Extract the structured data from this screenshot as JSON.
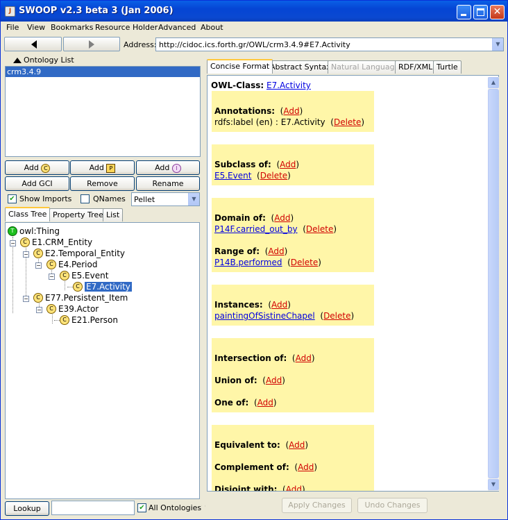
{
  "window": {
    "title": "SWOOP v2.3 beta 3 (Jan 2006)",
    "app_icon_glyph": "J"
  },
  "menu": [
    "File",
    "View",
    "Bookmarks",
    "Resource Holder",
    "Advanced",
    "About"
  ],
  "address": {
    "label": "Address:",
    "value": "http://cidoc.ics.forth.gr/OWL/crm3.4.9#E7.Activity"
  },
  "ontology_panel": {
    "header": "Ontology List",
    "items": [
      "crm3.4.9"
    ]
  },
  "buttons": {
    "add_class": "Add",
    "add_prop": "Add",
    "add_inst": "Add",
    "add_gci": "Add GCI",
    "remove": "Remove",
    "rename": "Rename",
    "class_badge": "C",
    "prop_badge": "P",
    "inst_badge": "I"
  },
  "options": {
    "show_imports": "Show Imports",
    "qnames": "QNames",
    "reasoner": "Pellet"
  },
  "left_tabs": [
    "Class Tree",
    "Property Tree",
    "List"
  ],
  "tree": {
    "thing_badge": "T",
    "class_badge": "C",
    "nodes": [
      "owl:Thing",
      "E1.CRM_Entity",
      "E2.Temporal_Entity",
      "E4.Period",
      "E5.Event",
      "E7.Activity",
      "E77.Persistent_Item",
      "E39.Actor",
      "E21.Person"
    ]
  },
  "bottom_left": {
    "lookup": "Lookup",
    "all_ontologies": "All Ontologies?"
  },
  "right_tabs": [
    "Concise Format",
    "Abstract Syntax",
    "Natural Language",
    "RDF/XML",
    "Turtle"
  ],
  "concise": {
    "class_label": "OWL-Class:",
    "class_name": "E7.Activity",
    "add": "Add",
    "delete": "Delete",
    "annotations_label": "Annotations:",
    "annotation_value": "rdfs:label (en) : E7.Activity",
    "subclass_label": "Subclass of:",
    "subclass_value": "E5.Event",
    "domain_label": "Domain of:",
    "domain_value": "P14F.carried_out_by",
    "range_label": "Range of:",
    "range_value": "P14B.performed",
    "instances_label": "Instances:",
    "instances_value": "paintingOfSistineChapel",
    "intersection_label": "Intersection of:",
    "union_label": "Union of:",
    "oneof_label": "One of:",
    "equivalent_label": "Equivalent to:",
    "complement_label": "Complement of:",
    "disjoint_label": "Disjoint with:"
  },
  "bottom_right": {
    "apply": "Apply Changes",
    "undo": "Undo Changes"
  }
}
